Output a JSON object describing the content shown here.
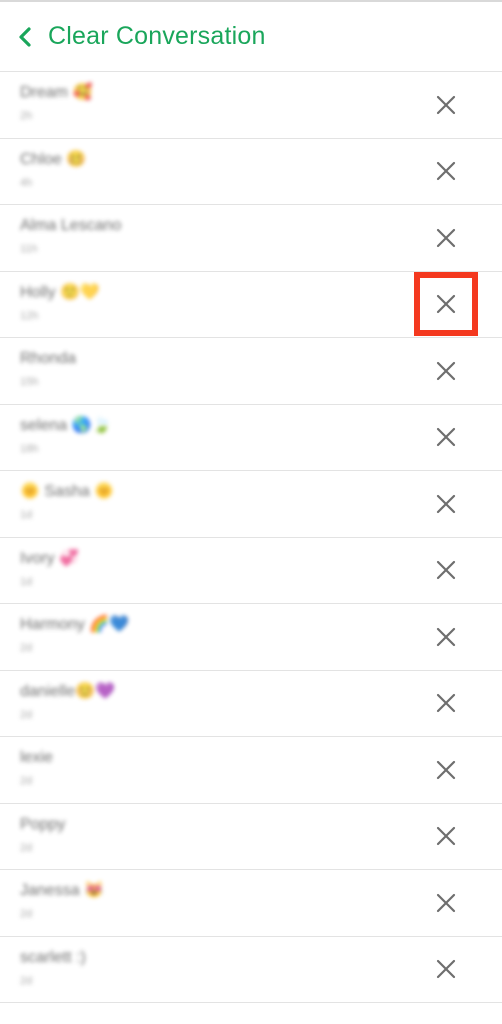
{
  "header": {
    "title": "Clear Conversation",
    "back_icon": "chevron-left-icon",
    "accent_color": "#1aa65b"
  },
  "highlight_color": "#f4391f",
  "clear_icon": "close-icon",
  "conversations": [
    {
      "name": "Dream 🥰",
      "time": "2h"
    },
    {
      "name": "Chloe 🥴",
      "time": "4h"
    },
    {
      "name": "Alma Lescano",
      "time": "11h"
    },
    {
      "name": "Holly 🙂💛",
      "time": "12h"
    },
    {
      "name": "Rhonda",
      "time": "15h"
    },
    {
      "name": "selena 🌎🍃",
      "time": "18h"
    },
    {
      "name": "🌞 Sasha 🌞",
      "time": "1d"
    },
    {
      "name": "Ivory 💞",
      "time": "1d"
    },
    {
      "name": "Harmony 🌈💙",
      "time": "2d"
    },
    {
      "name": "danielle😊💜",
      "time": "2d"
    },
    {
      "name": "lexie",
      "time": "2d"
    },
    {
      "name": "Poppy",
      "time": "2d"
    },
    {
      "name": "Janessa 😻",
      "time": "2d"
    },
    {
      "name": "scarlett :)",
      "time": "2d"
    }
  ]
}
